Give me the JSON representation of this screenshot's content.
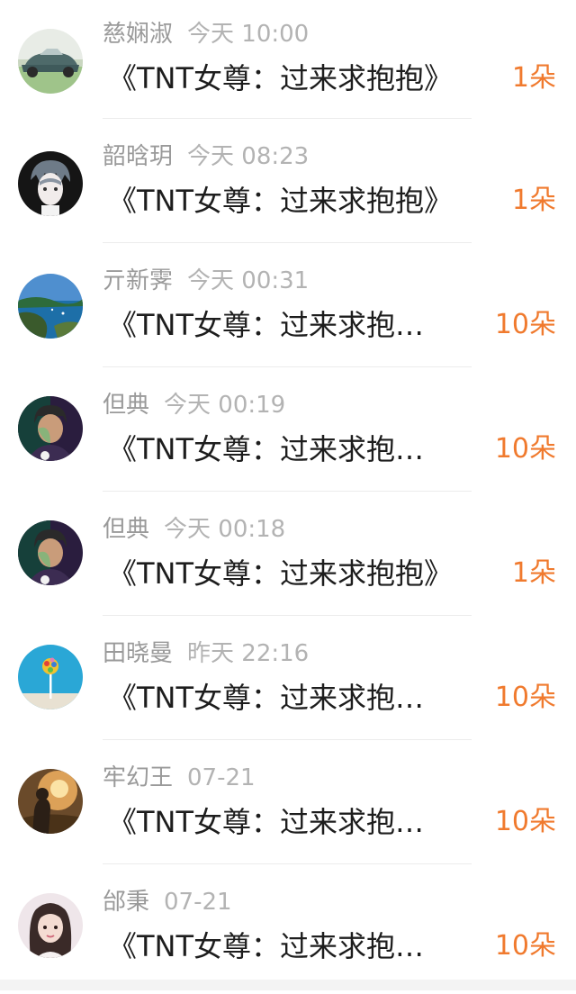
{
  "items": [
    {
      "name": "慈娴淑",
      "time": "今天 10:00",
      "message": "《TNT女尊：过来求抱抱》",
      "count": "1朵",
      "avatar": "vintage-car-avatar"
    },
    {
      "name": "韶晗玥",
      "time": "今天 08:23",
      "message": "《TNT女尊：过来求抱抱》",
      "count": "1朵",
      "avatar": "anime-boy-avatar"
    },
    {
      "name": "亓新霁",
      "time": "今天 00:31",
      "message": "《TNT女尊：过来求抱…",
      "count": "10朵",
      "avatar": "sea-cliff-avatar"
    },
    {
      "name": "但典",
      "time": "今天 00:19",
      "message": "《TNT女尊：过来求抱…",
      "count": "10朵",
      "avatar": "boy-portrait-avatar"
    },
    {
      "name": "但典",
      "time": "今天 00:18",
      "message": "《TNT女尊：过来求抱抱》",
      "count": "1朵",
      "avatar": "boy-portrait-avatar"
    },
    {
      "name": "田晓曼",
      "time": "昨天 22:16",
      "message": "《TNT女尊：过来求抱…",
      "count": "10朵",
      "avatar": "lollipop-avatar"
    },
    {
      "name": "牢幻王",
      "time": "07-21",
      "message": "《TNT女尊：过来求抱…",
      "count": "10朵",
      "avatar": "sunset-figure-avatar"
    },
    {
      "name": "邰秉",
      "time": "07-21",
      "message": "《TNT女尊：过来求抱…",
      "count": "10朵",
      "avatar": "girl-portrait-avatar"
    }
  ],
  "colors": {
    "name": "#9a9a9a",
    "time": "#b3b3b3",
    "message": "#1d1d1d",
    "count": "#f07a2e",
    "divider": "#ececec"
  }
}
